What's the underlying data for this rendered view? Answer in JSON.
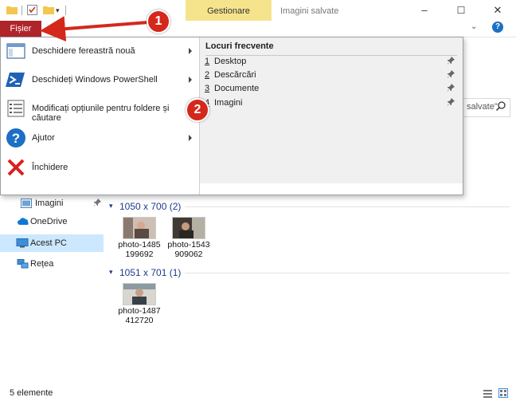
{
  "titlebar": {
    "contextual_tab": "Gestionare",
    "window_title": "Imagini salvate",
    "minimize": "–",
    "maximize": "☐",
    "close": "✕",
    "help": "?"
  },
  "ribbon": {
    "file_tab": "Fișier"
  },
  "search": {
    "text": "salvate\""
  },
  "file_menu": {
    "items": [
      {
        "label": "Deschidere fereastră nouă",
        "icon": "new-window-icon",
        "has_arrow": true
      },
      {
        "label": "Deschideți Windows PowerShell",
        "icon": "powershell-icon",
        "has_arrow": true
      },
      {
        "label": "Modificați opțiunile pentru foldere și căutare",
        "icon": "options-icon",
        "has_arrow": false
      },
      {
        "label": "Ajutor",
        "icon": "help-icon",
        "has_arrow": true
      },
      {
        "label": "Închidere",
        "icon": "close-icon",
        "has_arrow": false
      }
    ],
    "frequent": {
      "heading": "Locuri frecvente",
      "items": [
        {
          "num": "1",
          "label": "Desktop"
        },
        {
          "num": "2",
          "label": "Descărcări"
        },
        {
          "num": "3",
          "label": "Documente"
        },
        {
          "num": "4",
          "label": "Imagini"
        }
      ]
    }
  },
  "nav": {
    "items": [
      {
        "label": "Imagini",
        "icon": "pictures-folder-icon",
        "pinned": true
      },
      {
        "label": "OneDrive",
        "icon": "onedrive-icon"
      },
      {
        "label": "Acest PC",
        "icon": "this-pc-icon",
        "selected": true
      },
      {
        "label": "Rețea",
        "icon": "network-icon"
      }
    ]
  },
  "content": {
    "groups": [
      {
        "header": "1050 x 700 (2)",
        "files": [
          {
            "line1": "photo-1485",
            "line2": "199692"
          },
          {
            "line1": "photo-1543",
            "line2": "909062"
          }
        ]
      },
      {
        "header": "1051 x 701 (1)",
        "files": [
          {
            "line1": "photo-1487",
            "line2": "412720"
          }
        ]
      }
    ]
  },
  "status": {
    "text": "5 elemente"
  },
  "annotations": {
    "callout_1": "1",
    "callout_2": "2"
  },
  "colors": {
    "file_tab": "#b0252a",
    "contextual_tab": "#f6e48c",
    "callout": "#d4281c",
    "group_header": "#1e3b8a"
  }
}
